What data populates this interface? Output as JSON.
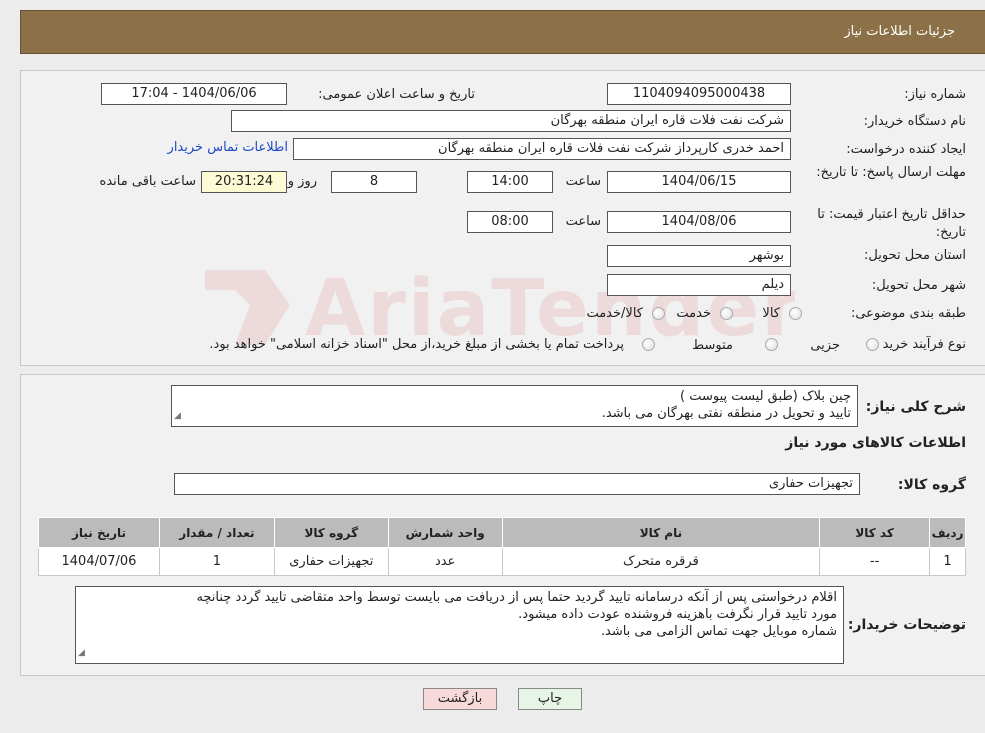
{
  "header": {
    "title": "جزئیات اطلاعات نیاز"
  },
  "form": {
    "need_number_label": "شماره نیاز:",
    "need_number": "1104094095000438",
    "announce_label": "تاریخ و ساعت اعلان عمومی:",
    "announce_value": "1404/06/06 - 17:04",
    "buyer_org_label": "نام دستگاه خریدار:",
    "buyer_org": "شرکت نفت فلات قاره ایران منطقه بهرگان",
    "creator_label": "ایجاد کننده درخواست:",
    "creator": "احمد خدری کارپرداز شرکت نفت فلات قاره ایران منطقه بهرگان",
    "contact_link": "اطلاعات تماس خریدار",
    "deadline_label": "مهلت ارسال پاسخ: تا تاریخ:",
    "deadline_date": "1404/06/15",
    "time_label": "ساعت",
    "deadline_time": "14:00",
    "days_value": "8",
    "days_label": "روز و",
    "remaining_time": "20:31:24",
    "remaining_label": "ساعت باقی مانده",
    "validity_label": "حداقل تاریخ اعتبار قیمت: تا تاریخ:",
    "validity_date": "1404/08/06",
    "validity_time": "08:00",
    "province_label": "استان محل تحویل:",
    "province": "بوشهر",
    "city_label": "شهر محل تحویل:",
    "city": "دیلم",
    "category_label": "طبقه بندی موضوعی:",
    "category_options": [
      "کالا",
      "خدمت",
      "کالا/خدمت"
    ],
    "process_label": "نوع فرآیند خرید :",
    "process_options": [
      "جزیی",
      "متوسط"
    ],
    "process_note": "پرداخت تمام یا بخشی از مبلغ خرید،از محل \"اسناد خزانه اسلامی\" خواهد بود."
  },
  "description": {
    "label": "شرح کلی نیاز:",
    "line1": "چین بلاک (طبق لیست پیوست )",
    "line2": "تایید و تحویل در منطقه نفتی بهرگان می باشد."
  },
  "goods": {
    "section_title": "اطلاعات کالاهای مورد نیاز",
    "group_label": "گروه کالا:",
    "group_value": "تجهیزات حفاری",
    "columns": [
      "ردیف",
      "کد کالا",
      "نام کالا",
      "واحد شمارش",
      "گروه کالا",
      "تعداد / مقدار",
      "تاریخ نیاز"
    ],
    "rows": [
      [
        "1",
        "--",
        "قرقره متحرک",
        "عدد",
        "تجهیزات حفاری",
        "1",
        "1404/07/06"
      ]
    ]
  },
  "buyer_notes": {
    "label": "توضیحات خریدار:",
    "line1": "اقلام درخواستی پس از آنکه درسامانه تایید گردید حتما پس از دریافت می بایست توسط واحد متقاضی تایید گردد چنانچه",
    "line2": "مورد تایید قرار نگرفت باهزینه فروشنده عودت داده میشود.",
    "line3": "شماره موبایل جهت تماس الزامی می باشد."
  },
  "buttons": {
    "print": "چاپ",
    "back": "بازگشت"
  },
  "colors": {
    "header": "#8c7047",
    "back_button": "#f7d9d9",
    "print_button": "#e6f5e6"
  }
}
